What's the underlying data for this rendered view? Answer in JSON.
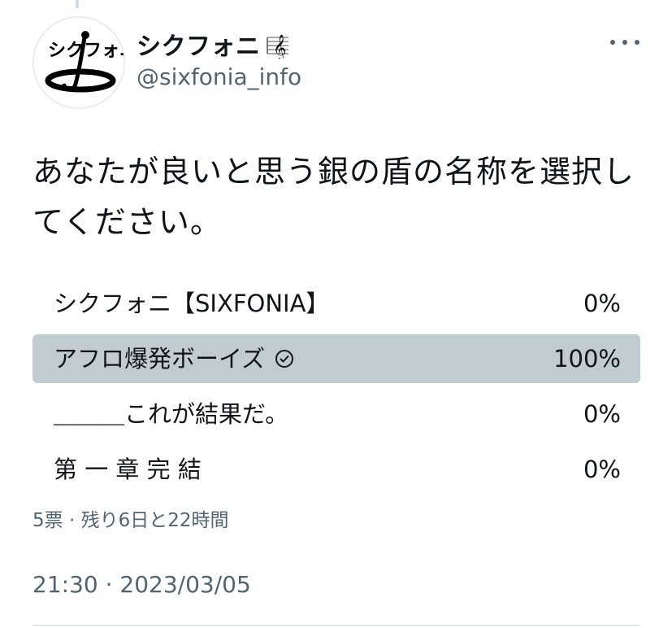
{
  "tweet": {
    "author": {
      "display_name": "シクフォニ",
      "handle": "@sixfonia_info",
      "name_badge_icon": "treble-clef-icon",
      "avatar_text": "シクフォニ"
    },
    "text": "あなたが良いと思う銀の盾の名称を選択してください。",
    "poll": {
      "options": [
        {
          "label": "シクフォニ【SIXFONIA】",
          "percent": "0%",
          "fraction": 0,
          "winner": false
        },
        {
          "label": "アフロ爆発ボーイズ",
          "percent": "100%",
          "fraction": 1,
          "winner": true
        },
        {
          "label": "＿＿＿これが結果だ。",
          "percent": "0%",
          "fraction": 0,
          "winner": false
        },
        {
          "label": "第 一 章 完 結",
          "percent": "0%",
          "fraction": 0,
          "winner": false
        }
      ],
      "meta": "5票 · 残り6日と22時間"
    },
    "timestamp": "21:30 · 2023/03/05"
  },
  "colors": {
    "winner_bar": "#c1ccd2",
    "secondary_text": "#536471",
    "primary_text": "#0f1419"
  }
}
